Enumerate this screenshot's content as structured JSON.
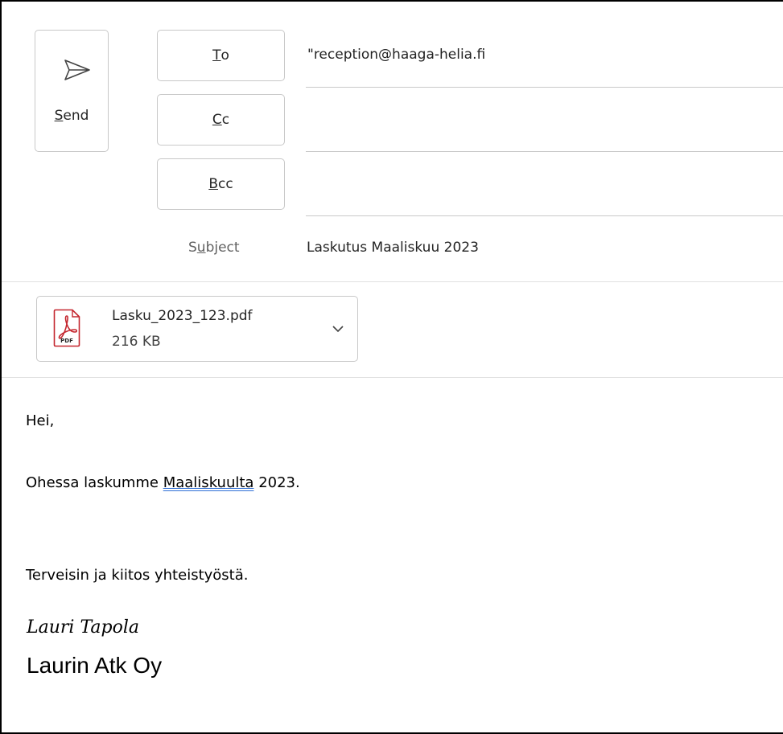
{
  "compose": {
    "send_button": {
      "label_underlined": "S",
      "label_rest": "end"
    },
    "to_button": {
      "label_underlined": "T",
      "label_rest": "o"
    },
    "cc_button": {
      "label_underlined": "C",
      "label_rest": "c"
    },
    "bcc_button": {
      "label_underlined": "B",
      "label_rest": "cc"
    },
    "to_value": "\"reception@haaga-helia.fi",
    "cc_value": "",
    "bcc_value": "",
    "subject_label_pre": "S",
    "subject_label_underlined": "u",
    "subject_label_post": "bject",
    "subject_value": "Laskutus Maaliskuu 2023"
  },
  "attachment": {
    "icon": "pdf-icon",
    "icon_label": "PDF",
    "name": "Lasku_2023_123.pdf",
    "size": "216 KB"
  },
  "body": {
    "greeting": "Hei,",
    "line1_pre": "Ohessa laskumme ",
    "line1_flagged": "Maaliskuulta",
    "line1_post": " 2023.",
    "closing": "Terveisin ja kiitos yhteistyöstä.",
    "signature_name": "Lauri Tapola",
    "signature_company": "Laurin Atk Oy"
  },
  "colors": {
    "accent": "#c4262e",
    "spellcheck": "#2f6fd6"
  }
}
